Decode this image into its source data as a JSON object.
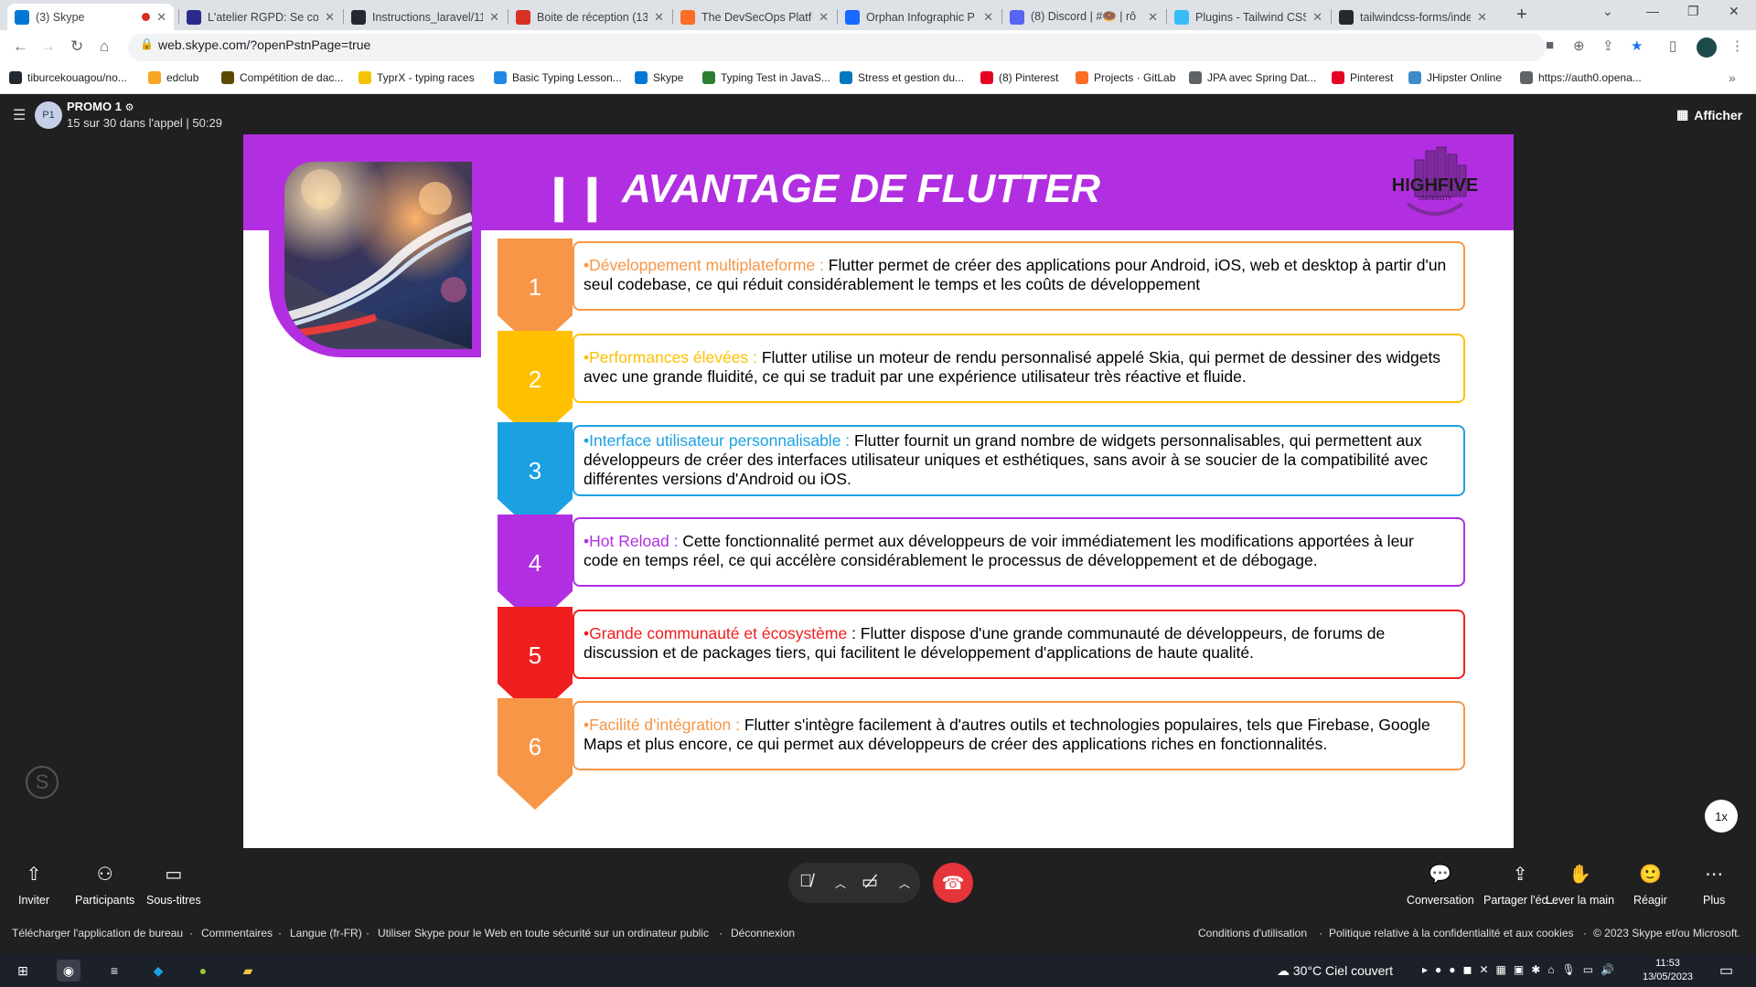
{
  "browser": {
    "tabs": [
      {
        "label": "(3) Skype",
        "icon": "skype-icon",
        "color": "#0078d4"
      },
      {
        "label": "L'atelier RGPD: Se con",
        "icon": "c-icon",
        "color": "#2a2a8a"
      },
      {
        "label": "Instructions_laravel/11",
        "icon": "github-icon",
        "color": "#24292f"
      },
      {
        "label": "Boite de réception (13",
        "icon": "gmail-icon",
        "color": "#d93025"
      },
      {
        "label": "The DevSecOps Platfo",
        "icon": "gitlab-icon",
        "color": "#fc6d26"
      },
      {
        "label": "Orphan Infographic P",
        "icon": "behance-icon",
        "color": "#1769ff"
      },
      {
        "label": "(8) Discord | #🍩 | rô",
        "icon": "discord-icon",
        "color": "#5865f2"
      },
      {
        "label": "Plugins - Tailwind CSS",
        "icon": "tailwind-icon",
        "color": "#38bdf8"
      },
      {
        "label": "tailwindcss-forms/inde",
        "icon": "github-icon",
        "color": "#24292f"
      }
    ],
    "url": "web.skype.com/?openPstnPage=true",
    "bookmarks": [
      {
        "label": "tiburcekouagou/no...",
        "icon": "github-icon",
        "color": "#24292f"
      },
      {
        "label": "edclub",
        "icon": "edclub-icon",
        "color": "#f5a623"
      },
      {
        "label": "Compétition de dac...",
        "icon": "bookmark-icon",
        "color": "#5a4a00"
      },
      {
        "label": "TyprX - typing races",
        "icon": "typrx-icon",
        "color": "#f5c400"
      },
      {
        "label": "Basic Typing Lesson...",
        "icon": "typing-icon",
        "color": "#1e88e5"
      },
      {
        "label": "Skype",
        "icon": "skype-icon",
        "color": "#0078d4"
      },
      {
        "label": "Typing Test in JavaS...",
        "icon": "t-icon",
        "color": "#2e7d32"
      },
      {
        "label": "Stress et gestion du...",
        "icon": "trello-icon",
        "color": "#0079bf"
      },
      {
        "label": "(8) Pinterest",
        "icon": "pinterest-icon",
        "color": "#e60023"
      },
      {
        "label": "Projects · GitLab",
        "icon": "gitlab-icon",
        "color": "#fc6d26"
      },
      {
        "label": "JPA avec Spring Dat...",
        "icon": "globe-icon",
        "color": "#5f6368"
      },
      {
        "label": "Pinterest",
        "icon": "pinterest-icon",
        "color": "#e60023"
      },
      {
        "label": "JHipster Online",
        "icon": "jhipster-icon",
        "color": "#3e8acc"
      },
      {
        "label": "https://auth0.opena...",
        "icon": "globe-icon",
        "color": "#5f6368"
      }
    ]
  },
  "call": {
    "avatar_initials": "P1",
    "title": "PROMO 1",
    "subtitle": "15 sur 30 dans l'appel | 50:29",
    "afficher_label": "Afficher"
  },
  "slide": {
    "title": "AVANTAGE DE FLUTTER",
    "logo_text": "HIGHFIVE",
    "logo_subtext": "UNIVERSITY",
    "items": [
      {
        "num": "1",
        "color": "#f79646",
        "lead": "•Développement multiplateforme :",
        "text": " Flutter permet de créer des applications pour Android, iOS, web et desktop à partir d'un seul codebase, ce qui réduit considérablement le temps et les coûts de développement"
      },
      {
        "num": "2",
        "color": "#ffc000",
        "lead": "•Performances élevées :",
        "text": " Flutter utilise un moteur de rendu personnalisé appelé Skia, qui permet de dessiner des widgets avec une grande fluidité, ce qui se traduit par une expérience utilisateur très réactive et fluide."
      },
      {
        "num": "3",
        "color": "#1ba1e2",
        "lead": "•Interface utilisateur personnalisable :",
        "text": " Flutter fournit un grand nombre de widgets personnalisables, qui permettent aux développeurs de créer des interfaces utilisateur uniques et esthétiques, sans avoir à se soucier de la compatibilité avec différentes versions d'Android ou iOS."
      },
      {
        "num": "4",
        "color": "#b12fe0",
        "lead": "•Hot Reload :",
        "text": " Cette fonctionnalité permet aux développeurs de voir immédiatement les modifications apportées à leur code en temps réel, ce qui accélère considérablement le processus de développement et de débogage."
      },
      {
        "num": "5",
        "color": "#f01e1e",
        "lead": "•Grande communauté et écosystème",
        "text": " : Flutter dispose d'une grande communauté de développeurs, de forums de discussion et de packages tiers, qui facilitent le développement d'applications de haute qualité."
      },
      {
        "num": "6",
        "color": "#f79646",
        "lead": "•Facilité d'intégration :",
        "text": " Flutter s'intègre facilement à d'autres outils et technologies populaires, tels que Firebase, Google Maps et plus encore, ce qui permet aux développeurs de créer des applications riches en fonctionnalités."
      }
    ]
  },
  "toolbar": {
    "left": [
      {
        "label": "Inviter",
        "icon": "share-icon"
      },
      {
        "label": "Participants",
        "icon": "participants-icon"
      },
      {
        "label": "Sous-titres",
        "icon": "captions-icon"
      }
    ],
    "right": [
      {
        "label": "Conversation",
        "icon": "chat-icon"
      },
      {
        "label": "Partager l'éc...",
        "icon": "share-screen-icon"
      },
      {
        "label": "Lever la main",
        "icon": "hand-icon"
      },
      {
        "label": "Réagir",
        "icon": "react-icon"
      },
      {
        "label": "Plus",
        "icon": "more-icon"
      }
    ],
    "speed": "1x"
  },
  "footer": {
    "left": [
      "Télécharger l'application de bureau",
      "Commentaires",
      "Langue (fr-FR)",
      "Utiliser Skype pour le Web en toute sécurité sur un ordinateur public",
      "Déconnexion"
    ],
    "right": [
      "Conditions d'utilisation",
      "Politique relative à la confidentialité et aux cookies",
      "© 2023 Skype et/ou Microsoft."
    ]
  },
  "taskbar": {
    "weather": "30°C  Ciel couvert",
    "time": "11:53",
    "date": "13/05/2023"
  }
}
